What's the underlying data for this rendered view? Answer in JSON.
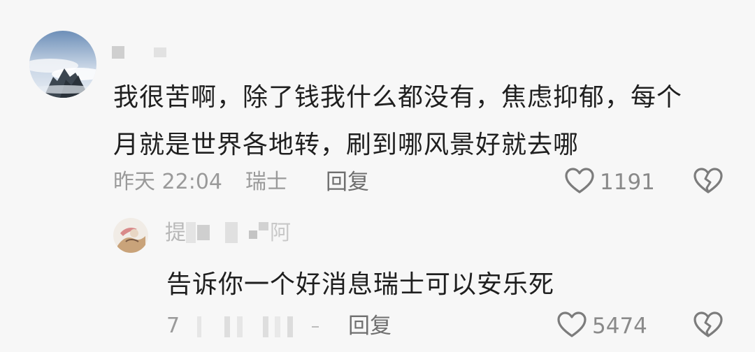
{
  "main_comment": {
    "avatar_icon": "mountain-landscape-avatar",
    "text_line1": "我很苦啊，除了钱我什么都没有，焦虑抑郁，每个",
    "text_line2": "月就是世界各地转，刷到哪风景好就去哪",
    "date": "昨天 22:04",
    "location": "瑞士",
    "reply_label": "回复",
    "like_icon": "heart-outline-icon",
    "like_count": "1191",
    "dislike_icon": "broken-heart-icon"
  },
  "reply_comment": {
    "avatar_icon": "illustrated-avatar",
    "name_start": "提",
    "name_end": "阿",
    "text": "告诉你一个好消息瑞士可以安乐死",
    "date": "7",
    "reply_label": "回复",
    "like_icon": "heart-outline-icon",
    "like_count": "5474",
    "dislike_icon": "broken-heart-icon"
  },
  "colors": {
    "background": "#f7f7f7",
    "text": "#1f1f1f",
    "meta": "#9a9a9a"
  }
}
